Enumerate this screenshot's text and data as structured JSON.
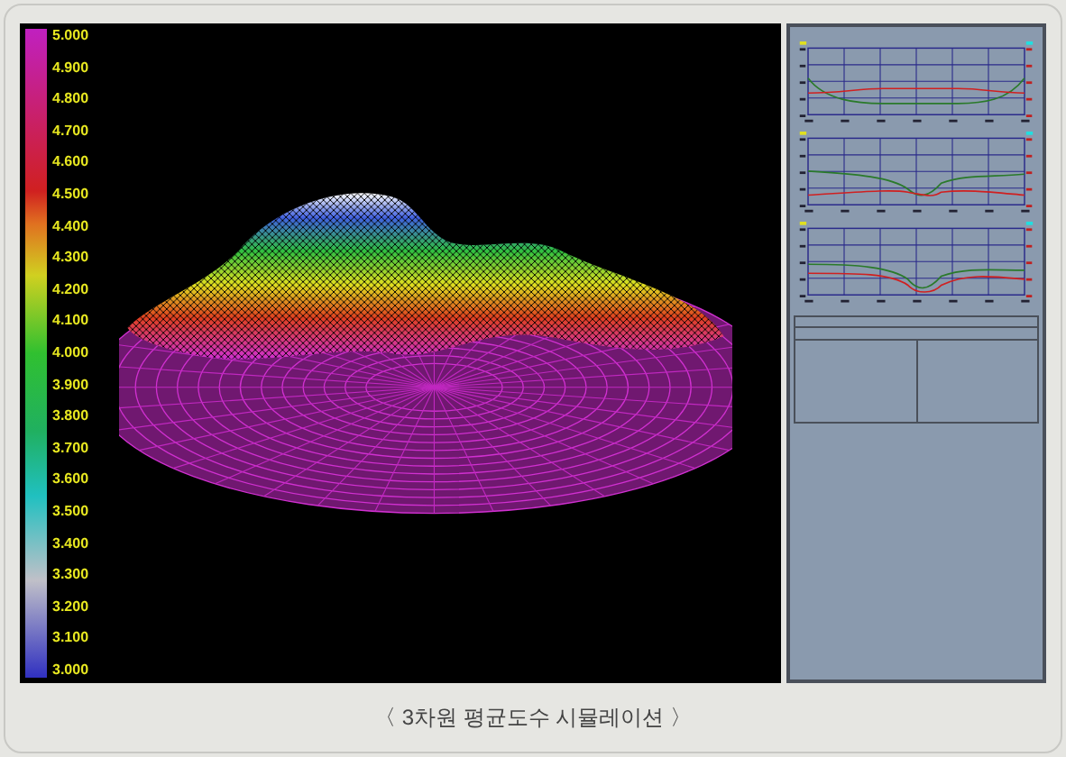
{
  "color_scale": {
    "labels": [
      "5.000",
      "4.900",
      "4.800",
      "4.700",
      "4.600",
      "4.500",
      "4.400",
      "4.300",
      "4.200",
      "4.100",
      "4.000",
      "3.900",
      "3.800",
      "3.700",
      "3.600",
      "3.500",
      "3.400",
      "3.300",
      "3.200",
      "3.100",
      "3.000"
    ]
  },
  "caption": "〈 3차원 평균도수 시뮬레이션 〉"
}
